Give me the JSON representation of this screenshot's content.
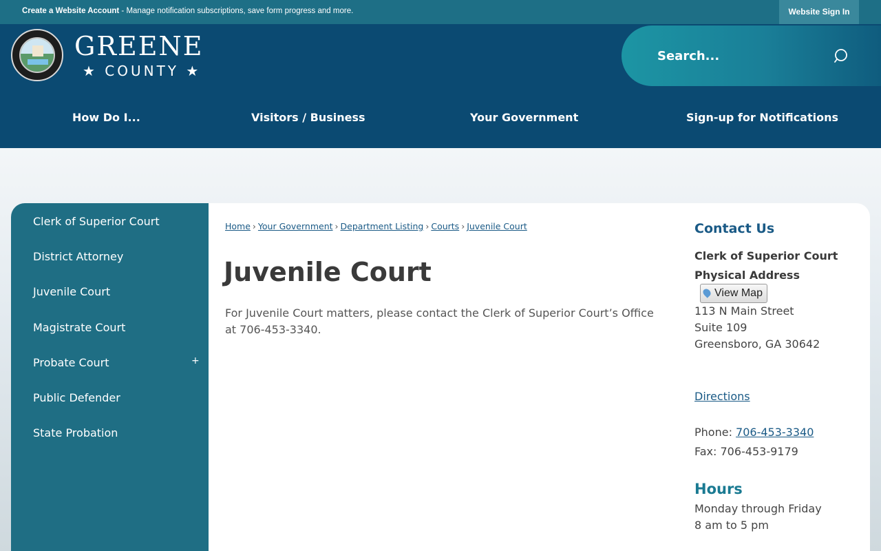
{
  "topbar": {
    "create_account": "Create a Website Account",
    "message": " - Manage notification subscriptions, save form progress and more.",
    "sign_in": "Website Sign In"
  },
  "header": {
    "logo_word": "GREENE",
    "logo_county": "★ COUNTY ★",
    "search_placeholder": "Search..."
  },
  "nav": {
    "items": [
      {
        "label": "How Do I..."
      },
      {
        "label": "Visitors / Business"
      },
      {
        "label": "Your Government"
      },
      {
        "label": "Sign-up for Notifications"
      }
    ]
  },
  "sidebar": {
    "items": [
      {
        "label": "Clerk of Superior Court"
      },
      {
        "label": "District Attorney"
      },
      {
        "label": "Juvenile Court"
      },
      {
        "label": "Magistrate Court"
      },
      {
        "label": "Probate Court"
      },
      {
        "label": "Public Defender"
      },
      {
        "label": "State Probation"
      }
    ],
    "expand": "+"
  },
  "breadcrumb": {
    "items": [
      "Home",
      "Your Government",
      "Department Listing",
      "Courts",
      "Juvenile Court"
    ],
    "separator": "›"
  },
  "main": {
    "title": "Juvenile Court",
    "body": "For Juvenile Court matters, please contact the Clerk of Superior Court’s Office at 706-453-3340."
  },
  "contact": {
    "heading": "Contact Us",
    "name": "Clerk of Superior Court",
    "physical_address_label": "Physical Address",
    "view_map": "View Map",
    "address_line1": "113 N Main Street",
    "address_line2": "Suite 109",
    "address_line3": "Greensboro, GA 30642",
    "directions": "Directions",
    "phone_label": "Phone: ",
    "phone": "706-453-3340",
    "fax_label": "Fax: ",
    "fax": "706-453-9179",
    "hours_heading": "Hours",
    "hours_line1": "Monday through Friday",
    "hours_line2": "8 am to 5 pm"
  },
  "colors": {
    "topbar": "#1e6f86",
    "header": "#0b4a72",
    "sidebar": "#1f6e84",
    "link": "#1a5a86"
  }
}
